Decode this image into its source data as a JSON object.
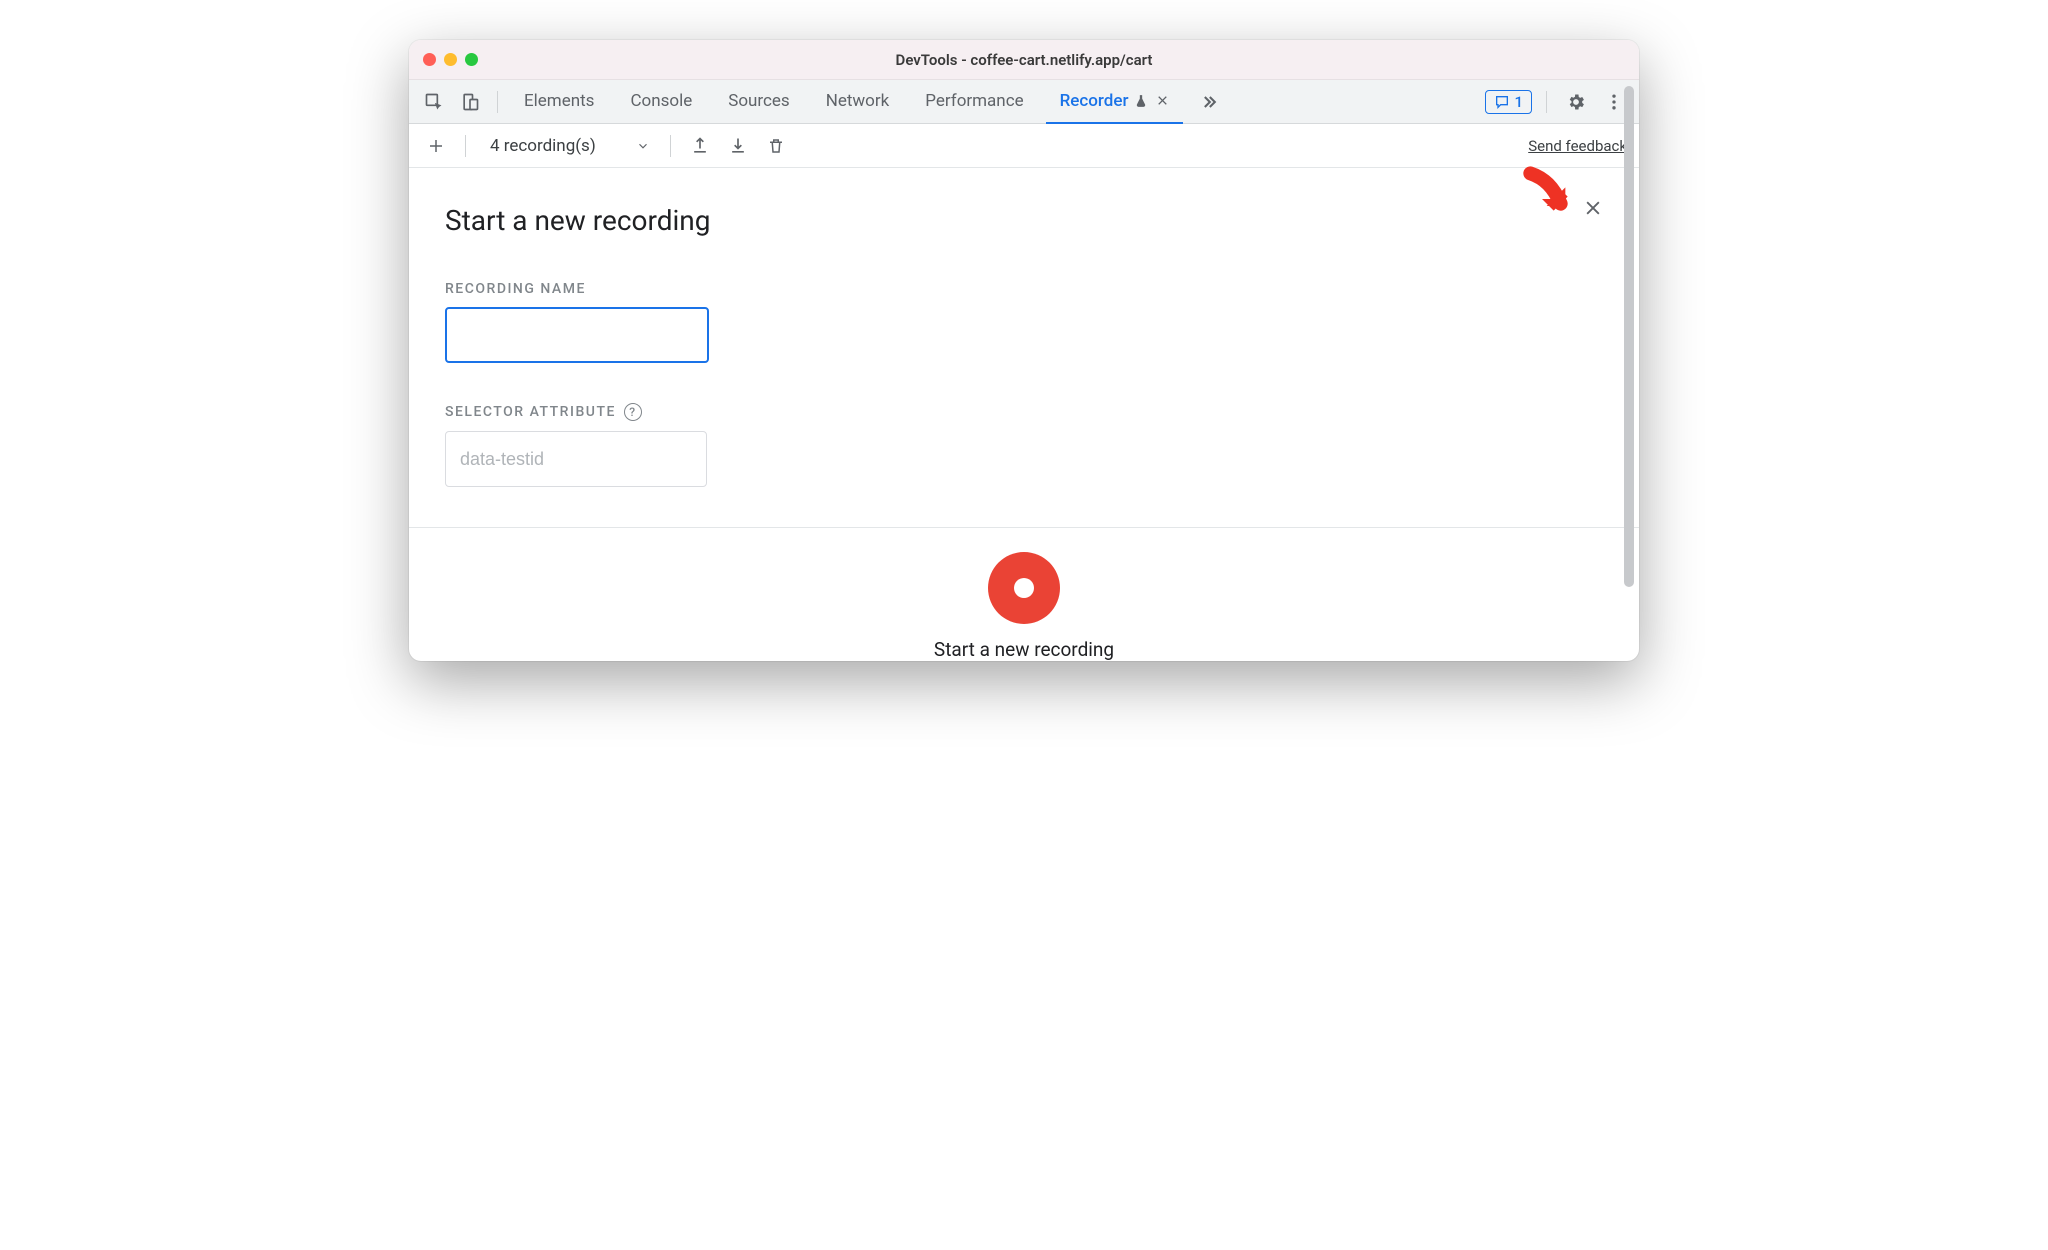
{
  "window": {
    "title": "DevTools - coffee-cart.netlify.app/cart"
  },
  "tabs": {
    "items": [
      "Elements",
      "Console",
      "Sources",
      "Network",
      "Performance",
      "Recorder"
    ],
    "activeIndex": 5,
    "message_count": "1"
  },
  "toolbar": {
    "recordings_label": "4 recording(s)",
    "feedback": "Send feedback"
  },
  "panel": {
    "title": "Start a new recording",
    "recording_name_label": "RECORDING NAME",
    "recording_name_value": "",
    "selector_label": "SELECTOR ATTRIBUTE",
    "selector_placeholder": "data-testid",
    "cta_label": "Start a new recording"
  }
}
